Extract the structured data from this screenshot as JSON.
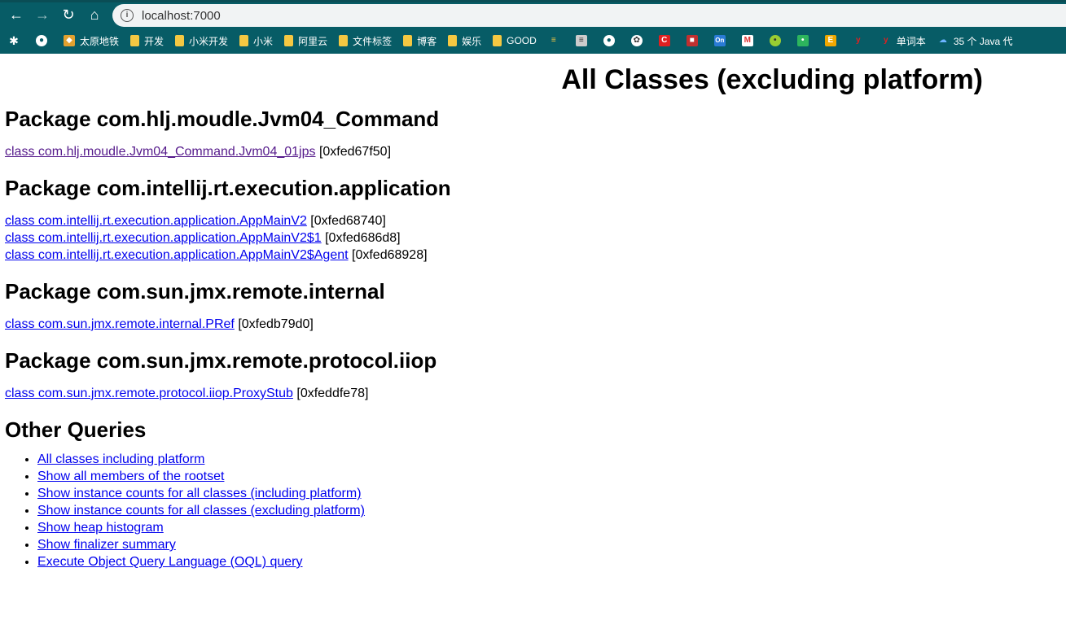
{
  "browser": {
    "url": "localhost:7000",
    "bookmarks": [
      {
        "label": "",
        "icon": "extensions-icon"
      },
      {
        "label": "",
        "icon": "github-icon"
      },
      {
        "label": "太原地铁",
        "icon": "folder-icon"
      },
      {
        "label": "开发",
        "icon": "folder-icon"
      },
      {
        "label": "小米开发",
        "icon": "folder-icon"
      },
      {
        "label": "小米",
        "icon": "folder-icon"
      },
      {
        "label": "阿里云",
        "icon": "folder-icon"
      },
      {
        "label": "文件标签",
        "icon": "folder-icon"
      },
      {
        "label": "博客",
        "icon": "folder-icon"
      },
      {
        "label": "娱乐",
        "icon": "folder-icon"
      },
      {
        "label": "GOOD",
        "icon": "folder-icon"
      },
      {
        "label": "单词本",
        "icon": "y-icon"
      },
      {
        "label": "35 个 Java 代",
        "icon": "cloud-icon"
      }
    ]
  },
  "page": {
    "title": "All Classes (excluding platform)",
    "packages": [
      {
        "heading": "Package com.hlj.moudle.Jvm04_Command",
        "classes": [
          {
            "link": "class com.hlj.moudle.Jvm04_Command.Jvm04_01jps",
            "addr": " [0xfed67f50]",
            "visited": true
          }
        ]
      },
      {
        "heading": "Package com.intellij.rt.execution.application",
        "classes": [
          {
            "link": "class com.intellij.rt.execution.application.AppMainV2",
            "addr": " [0xfed68740]"
          },
          {
            "link": "class com.intellij.rt.execution.application.AppMainV2$1",
            "addr": " [0xfed686d8]"
          },
          {
            "link": "class com.intellij.rt.execution.application.AppMainV2$Agent",
            "addr": " [0xfed68928]"
          }
        ]
      },
      {
        "heading": "Package com.sun.jmx.remote.internal",
        "classes": [
          {
            "link": "class com.sun.jmx.remote.internal.PRef",
            "addr": " [0xfedb79d0]"
          }
        ]
      },
      {
        "heading": "Package com.sun.jmx.remote.protocol.iiop",
        "classes": [
          {
            "link": "class com.sun.jmx.remote.protocol.iiop.ProxyStub",
            "addr": " [0xfeddfe78]"
          }
        ]
      }
    ],
    "other_heading": "Other Queries",
    "other_queries": [
      "All classes including platform",
      "Show all members of the rootset",
      "Show instance counts for all classes (including platform)",
      "Show instance counts for all classes (excluding platform)",
      "Show heap histogram",
      "Show finalizer summary",
      "Execute Object Query Language (OQL) query"
    ]
  }
}
